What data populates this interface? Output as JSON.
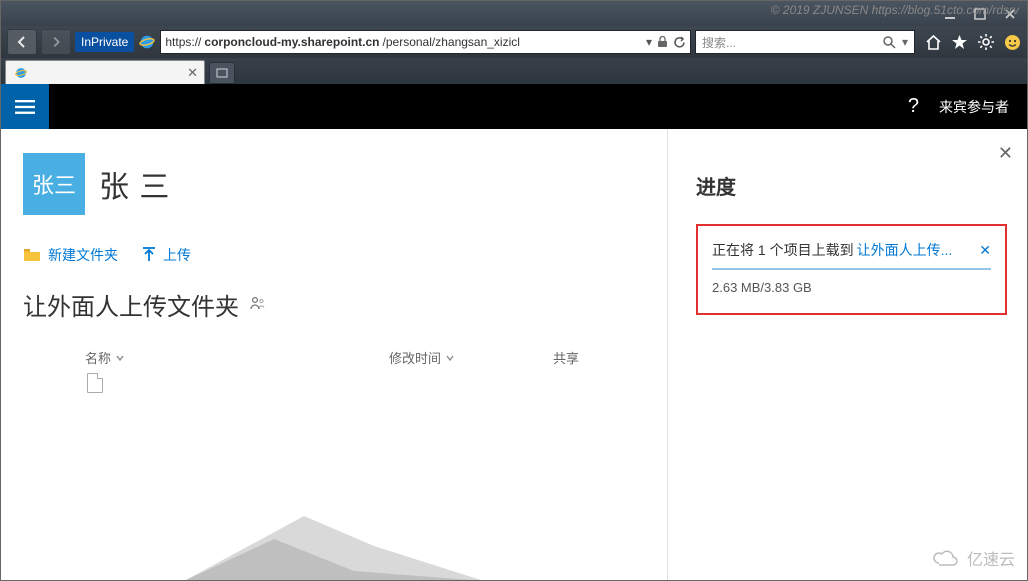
{
  "watermark_top": "© 2019 ZJUNSEN https://blog.51cto.com/rdsrv",
  "watermark_bottom": "亿速云",
  "browser": {
    "inprivate": "InPrivate",
    "url_prefix": "https://",
    "url_host": "corponcloud-my.sharepoint.cn",
    "url_path": "/personal/zhangsan_xizicl",
    "search_placeholder": "搜索..."
  },
  "tab": {
    "title": " "
  },
  "header": {
    "guest_label": "来宾参与者"
  },
  "owner": {
    "tile_text": "张三",
    "display_name": "张 三"
  },
  "actions": {
    "new_folder": "新建文件夹",
    "upload": "上传"
  },
  "folder": {
    "title": "让外面人上传文件夹"
  },
  "columns": {
    "name": "名称",
    "modified": "修改时间",
    "share": "共享"
  },
  "panel": {
    "title": "进度",
    "uploading_prefix": "正在将 1 个项目上载到",
    "uploading_target": "让外面人上传...",
    "progress_size": "2.63 MB/3.83 GB"
  }
}
